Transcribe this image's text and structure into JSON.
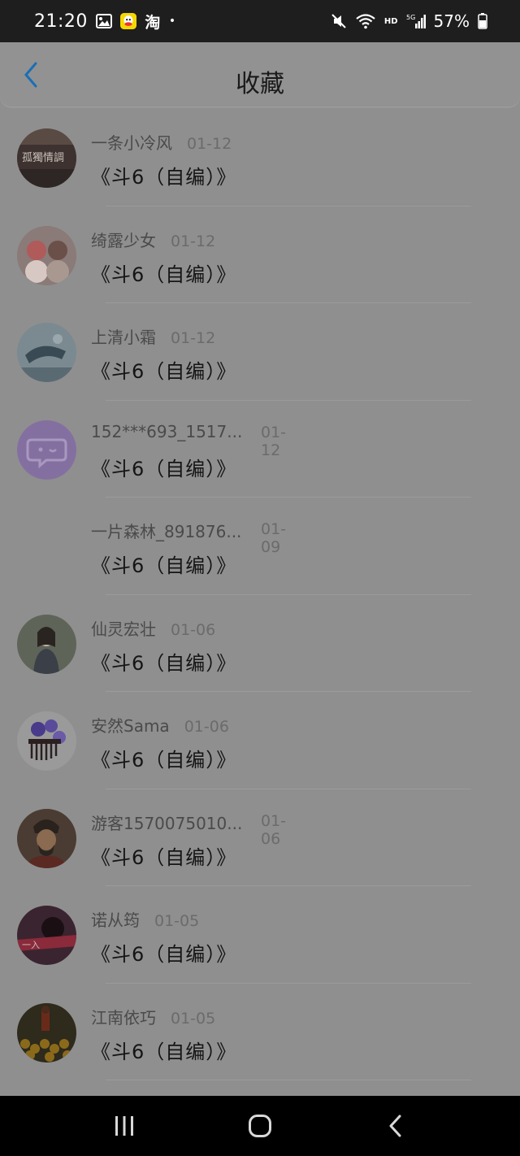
{
  "status_bar": {
    "time": "21:20",
    "app_icons": [
      "gallery-icon",
      "qq-icon",
      "taobao-icon"
    ],
    "taobao_label": "淘",
    "dot": "•",
    "hd": "HD",
    "battery": "57%"
  },
  "header": {
    "title": "收藏",
    "accent": "#1a6fb5"
  },
  "items": [
    {
      "name": "一条小冷风",
      "date": "01-12",
      "work": "《斗6（自编）》",
      "avatar": "dark-photo-avatar"
    },
    {
      "name": "绮露少女",
      "date": "01-12",
      "work": "《斗6（自编）》",
      "avatar": "two-girls-avatar"
    },
    {
      "name": "上清小霜",
      "date": "01-12",
      "work": "《斗6（自编）》",
      "avatar": "ink-painting-avatar"
    },
    {
      "name": "152***693_1517...",
      "date": "01-12",
      "work": "《斗6（自编）》",
      "avatar": "default-chat-avatar"
    },
    {
      "name": "一片森林_891876...",
      "date": "01-09",
      "work": "《斗6（自编）》",
      "avatar": "none"
    },
    {
      "name": "仙灵宏壮",
      "date": "01-06",
      "work": "《斗6（自编）》",
      "avatar": "girl-photo-avatar"
    },
    {
      "name": "安然Sama",
      "date": "01-06",
      "work": "《斗6（自编）》",
      "avatar": "flower-comb-avatar"
    },
    {
      "name": "游客1570075010...",
      "date": "01-06",
      "work": "《斗6（自编）》",
      "avatar": "warrior-avatar"
    },
    {
      "name": "诺从筠",
      "date": "01-05",
      "work": "《斗6（自编）》",
      "avatar": "red-figure-avatar"
    },
    {
      "name": "江南依巧",
      "date": "01-05",
      "work": "《斗6（自编）》",
      "avatar": "autumn-avatar"
    }
  ]
}
